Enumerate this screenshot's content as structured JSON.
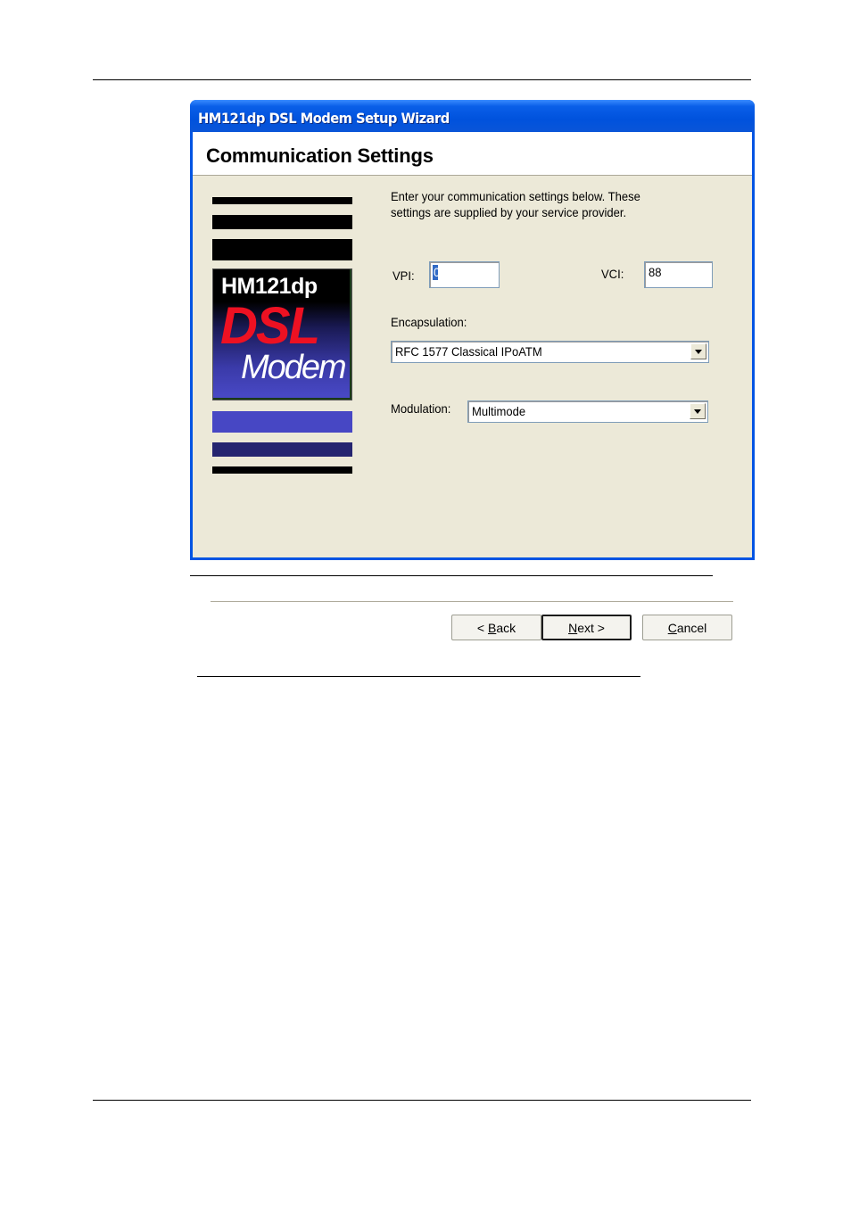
{
  "window": {
    "title": "HM121dp DSL Modem Setup Wizard",
    "page_heading": "Communication Settings"
  },
  "logo": {
    "model": "HM121dp",
    "line1": "DSL",
    "line2": "Modem",
    "colors": {
      "dsl": "#ee1122",
      "panel_bottom": "#4a4ac8"
    }
  },
  "form": {
    "description_line1": "Enter your communication settings below.  These",
    "description_line2": "settings are supplied by your service provider.",
    "vpi_label": "VPI:",
    "vpi_value": "0",
    "vci_label": "VCI:",
    "vci_value": "88",
    "encapsulation_label": "Encapsulation:",
    "encapsulation_value": "RFC 1577 Classical IPoATM",
    "modulation_label": "Modulation:",
    "modulation_value": "Multimode"
  },
  "buttons": {
    "back_prefix": "< ",
    "back_mnemonic": "B",
    "back_rest": "ack",
    "next_mnemonic": "N",
    "next_rest": "ext >",
    "cancel_mnemonic": "C",
    "cancel_rest": "ancel"
  }
}
